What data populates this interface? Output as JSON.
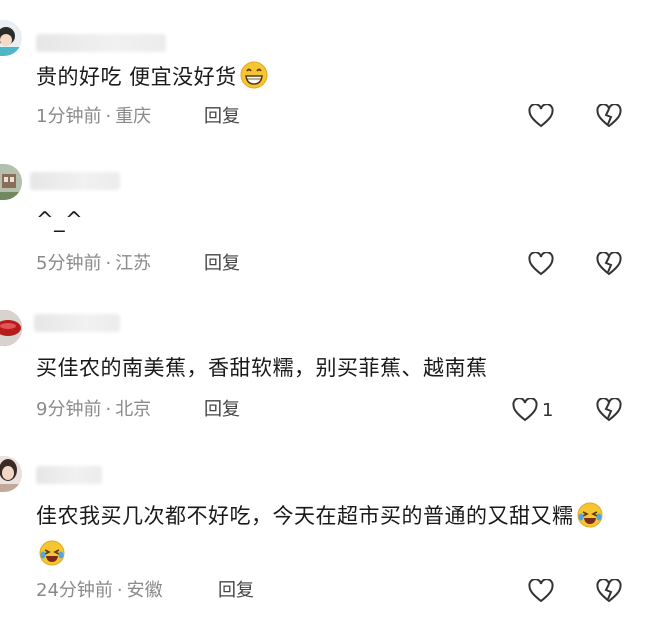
{
  "comments": [
    {
      "text": "贵的好吃 便宜没好货",
      "emoji_count": 1,
      "time": "1分钟前",
      "location": "重庆",
      "reply_label": "回复",
      "likes": ""
    },
    {
      "text": "^_^",
      "emoji_count": 0,
      "time": "5分钟前",
      "location": "江苏",
      "reply_label": "回复",
      "likes": ""
    },
    {
      "text": "买佳农的南美蕉，香甜软糯，别买菲蕉、越南蕉",
      "emoji_count": 0,
      "time": "9分钟前",
      "location": "北京",
      "reply_label": "回复",
      "likes": "1"
    },
    {
      "text": "佳农我买几次都不好吃，今天在超市买的普通的又甜又糯",
      "emoji_count": 2,
      "time": "24分钟前",
      "location": "安徽",
      "reply_label": "回复",
      "likes": ""
    }
  ],
  "separator": "·",
  "icons": {
    "like": "heart-outline-icon",
    "dislike": "broken-heart-icon",
    "emoji_1": "grinning-face-icon",
    "emoji_2": "rolling-laughing-face-icon"
  },
  "colors": {
    "meta_text": "#8a8a8a",
    "icon_stroke": "#333333",
    "emoji_yellow": "#f7c531"
  }
}
